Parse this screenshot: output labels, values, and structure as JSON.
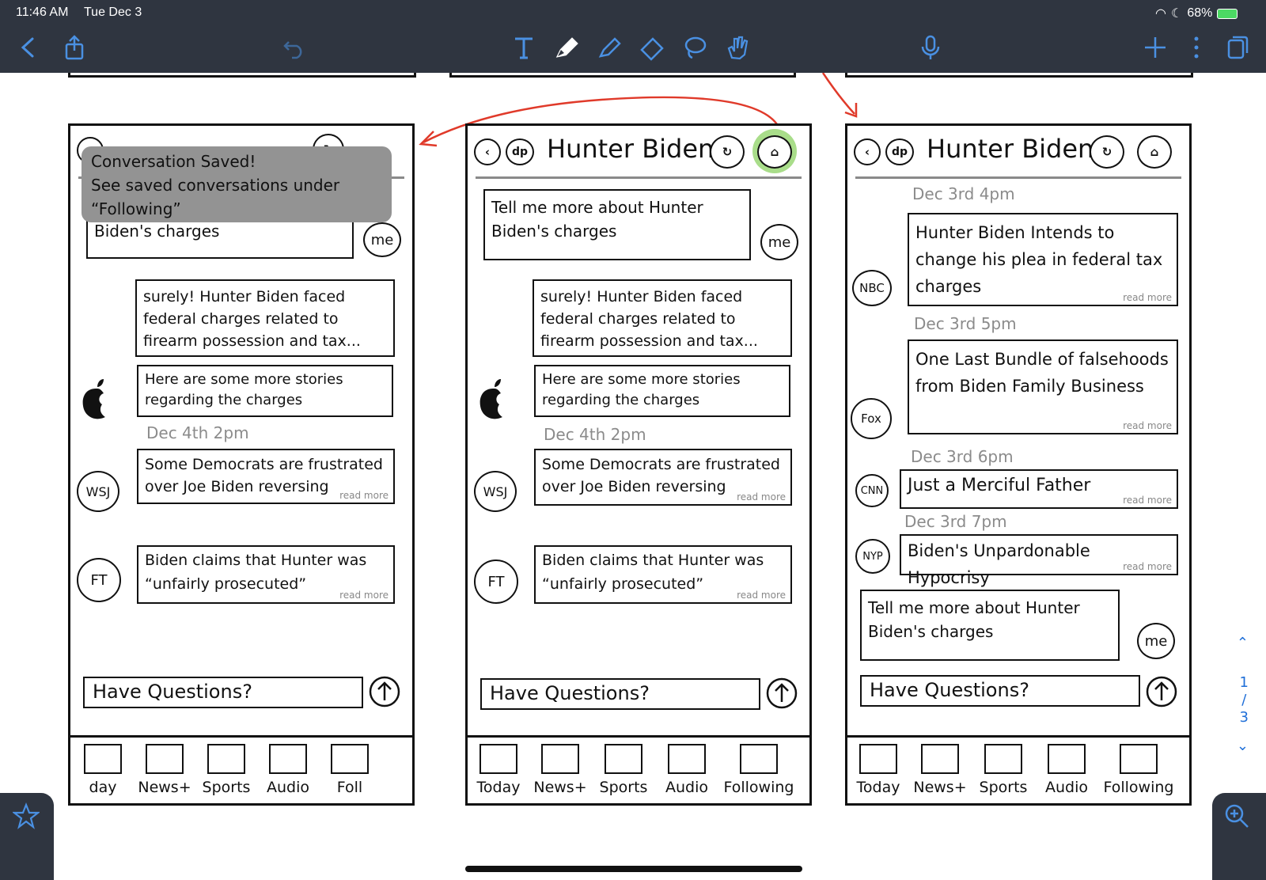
{
  "status_bar": {
    "time": "11:46 AM",
    "date": "Tue Dec 3",
    "battery": "68%"
  },
  "toolbar": {
    "left_icons": [
      "back-chevron-icon",
      "share-icon",
      "undo-icon"
    ],
    "tools": [
      "text-tool-icon",
      "pen-tool-icon",
      "highlighter-tool-icon",
      "eraser-tool-icon",
      "lasso-tool-icon",
      "hand-tool-icon"
    ],
    "right_icons": [
      "microphone-icon",
      "plus-icon",
      "more-icon",
      "pages-icon"
    ]
  },
  "page_nav": {
    "current": "1",
    "separator": "/",
    "total": "3"
  },
  "frames": [
    {
      "toast": {
        "line1": "Conversation Saved!",
        "line2": "See saved conversations under",
        "line3": "“Following”"
      },
      "user_bubble_text": "Biden's charges",
      "me_label": "me",
      "ai_reply": "surely! Hunter Biden faced federal charges related to firearm possession and tax...",
      "ai_more": "Here are some more stories regarding the charges",
      "date1": "Dec 4th 2pm",
      "story1_source": "WSJ",
      "story1_text": "Some Democrats are frustrated over Joe Biden reversing",
      "story1_more": "read more",
      "story2_source": "FT",
      "story2_text": "Biden claims that Hunter was “unfairly prosecuted”",
      "story2_more": "read more",
      "input_placeholder": "Have Questions?",
      "tabs": [
        "day",
        "News+",
        "Sports",
        "Audio",
        "Foll"
      ]
    },
    {
      "title": "Hunter Biden",
      "dp_label": "dp",
      "user_bubble_text": "Tell me more about Hunter Biden's charges",
      "me_label": "me",
      "ai_reply": "surely! Hunter Biden faced federal charges related to firearm possession and tax...",
      "ai_more": "Here are some more stories regarding the charges",
      "date1": "Dec 4th 2pm",
      "story1_source": "WSJ",
      "story1_text": "Some Democrats are frustrated over Joe Biden reversing",
      "story1_more": "read more",
      "story2_source": "FT",
      "story2_text": "Biden claims that Hunter was “unfairly prosecuted”",
      "story2_more": "read more",
      "input_placeholder": "Have Questions?",
      "tabs": [
        "Today",
        "News+",
        "Sports",
        "Audio",
        "Following"
      ]
    },
    {
      "title": "Hunter Biden",
      "dp_label": "dp",
      "items": [
        {
          "date": "Dec 3rd 4pm",
          "source": "NBC",
          "text": "Hunter Biden Intends to change his plea in federal tax charges",
          "more": "read more"
        },
        {
          "date": "Dec 3rd 5pm",
          "source": "Fox",
          "text": "One Last Bundle of falsehoods from Biden Family Business",
          "more": "read more"
        },
        {
          "date": "Dec 3rd 6pm",
          "source": "CNN",
          "text": "Just a Merciful Father",
          "more": "read more"
        },
        {
          "date": "Dec 3rd 7pm",
          "source": "NYP",
          "text": "Biden's Unpardonable Hypocrisy",
          "more": "read more"
        }
      ],
      "user_bubble_text": "Tell me more about Hunter Biden's charges",
      "me_label": "me",
      "input_placeholder": "Have Questions?",
      "tabs": [
        "Today",
        "News+",
        "Sports",
        "Audio",
        "Following"
      ]
    }
  ],
  "colors": {
    "toolbar_bg": "#2f3540",
    "toolbar_icon": "#4a90e2",
    "annotation_arrow": "#e03a2a",
    "bookmark_highlight": "#a9dd8a",
    "toast_bg": "#939393",
    "date_gray": "#8b8b8b"
  }
}
